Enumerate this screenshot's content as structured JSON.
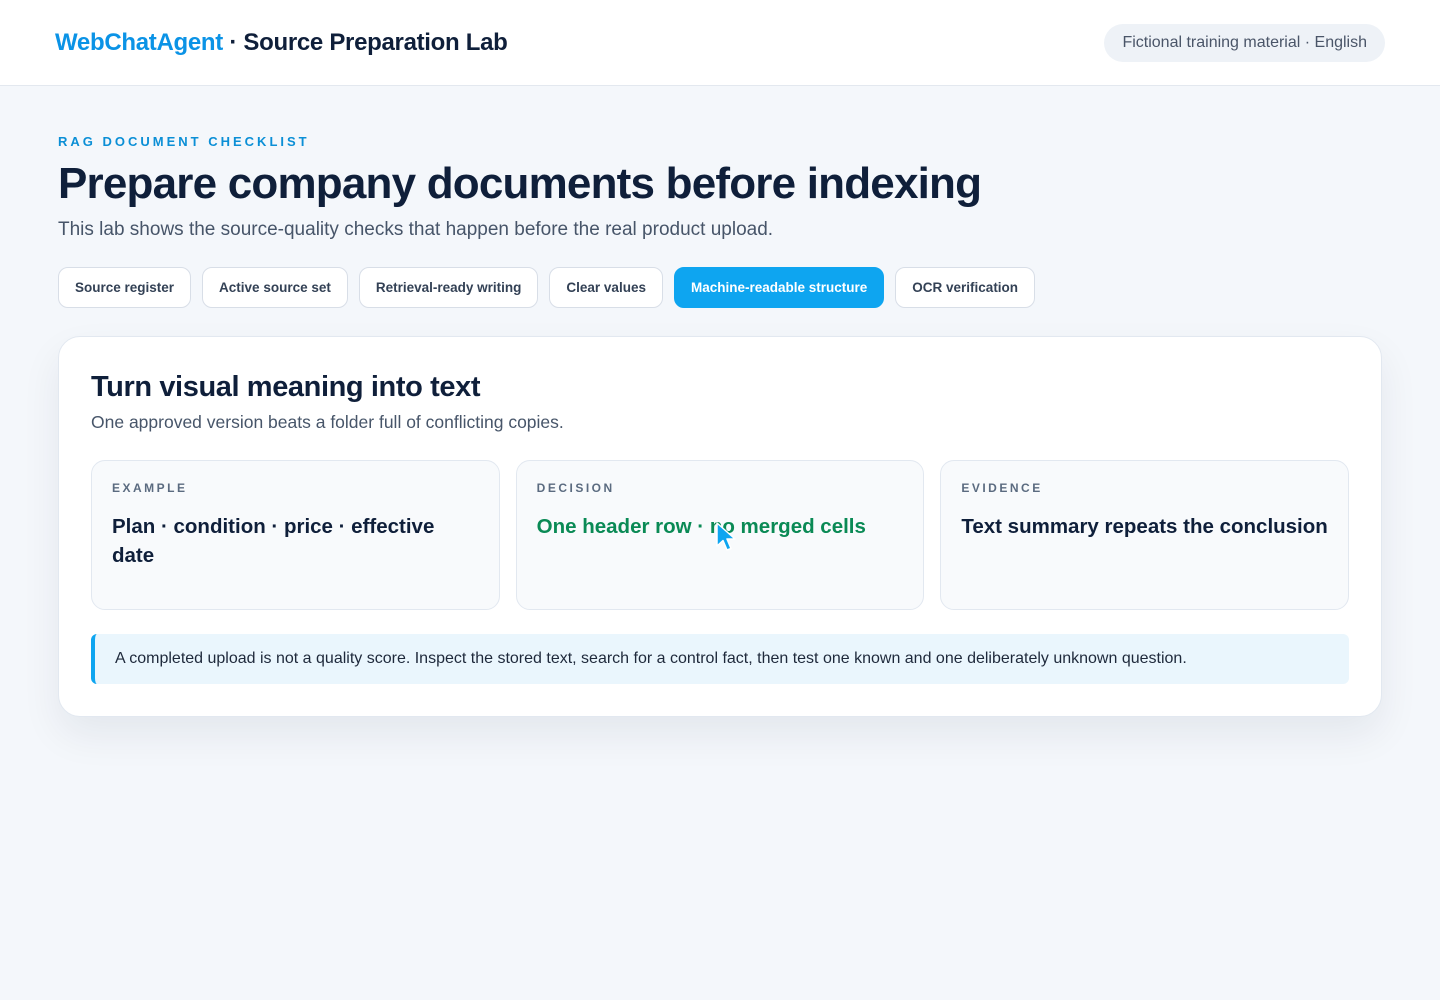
{
  "header": {
    "brand_name": "WebChatAgent",
    "brand_separator": " · ",
    "app_title": "Source Preparation Lab",
    "info_pill": "Fictional training material · English"
  },
  "main": {
    "eyebrow": "RAG DOCUMENT CHECKLIST",
    "title": "Prepare company documents before indexing",
    "subtitle": "This lab shows the source-quality checks that happen before the real product upload.",
    "tabs": [
      {
        "label": "Source register",
        "active": false
      },
      {
        "label": "Active source set",
        "active": false
      },
      {
        "label": "Retrieval-ready writing",
        "active": false
      },
      {
        "label": "Clear values",
        "active": false
      },
      {
        "label": "Machine-readable structure",
        "active": true
      },
      {
        "label": "OCR verification",
        "active": false
      }
    ]
  },
  "card": {
    "title": "Turn visual meaning into text",
    "subtitle": "One approved version beats a folder full of conflicting copies.",
    "columns": [
      {
        "label": "EXAMPLE",
        "text": "Plan · condition · price · effective date"
      },
      {
        "label": "DECISION",
        "text": "One header row · no merged cells"
      },
      {
        "label": "EVIDENCE",
        "text": "Text summary repeats the conclusion"
      }
    ],
    "note": "A completed upload is not a quality score. Inspect the stored text, search for a control fact, then test one known and one deliberately unknown question."
  },
  "colors": {
    "accent": "#0ea5f0",
    "brand": "#0b93e6",
    "decision_text": "#0a8a55"
  },
  "icons": {
    "cursor": "mouse-pointer-icon"
  }
}
